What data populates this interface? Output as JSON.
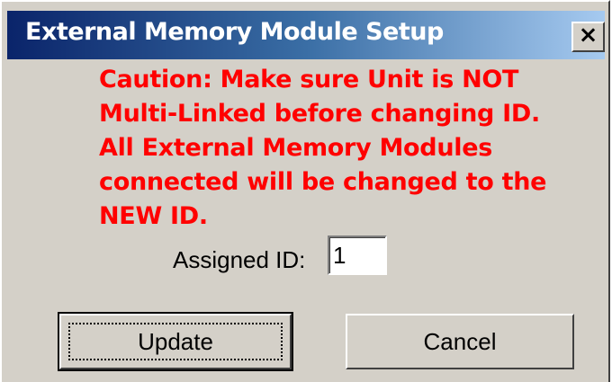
{
  "window": {
    "title": "External Memory Module Setup",
    "close_symbol": "×",
    "close_icon": "close-icon"
  },
  "message": {
    "color": "#ff0000",
    "lines": [
      "Caution: Make sure Unit is NOT",
      "Multi-Linked before changing ID.",
      "All External Memory Modules",
      "connected will be changed to the",
      "NEW ID."
    ]
  },
  "form": {
    "assigned_id_label": "Assigned ID:",
    "assigned_id_value": "1"
  },
  "buttons": {
    "update_label": "Update",
    "cancel_label": "Cancel"
  },
  "colors": {
    "title_gradient_start": "#0a246a",
    "title_gradient_end": "#a6caf0",
    "dialog_background": "#d4d0c8"
  }
}
